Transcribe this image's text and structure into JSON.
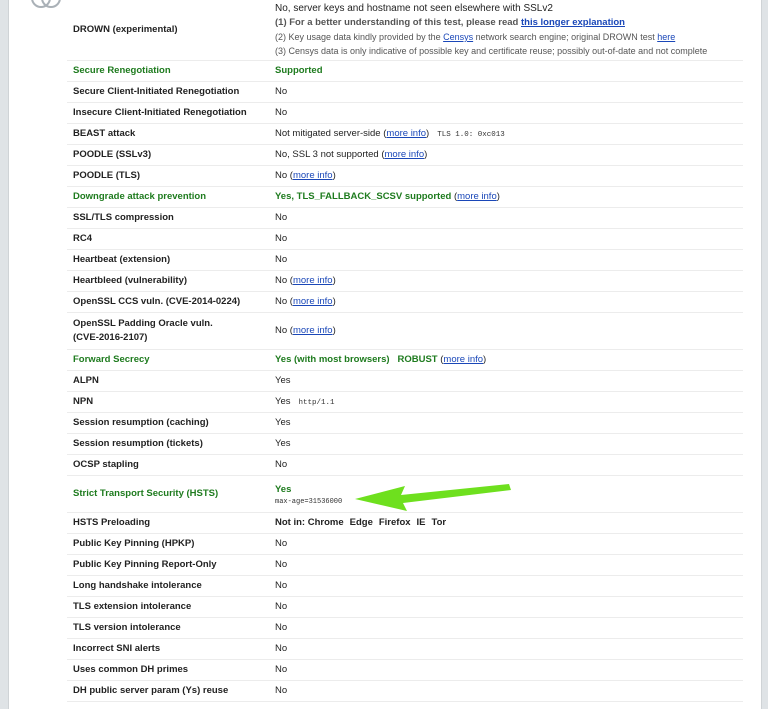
{
  "drown": {
    "label": "DROWN (experimental)",
    "line1": "No, server keys and hostname not seen elsewhere with SSLv2",
    "line2_prefix": "(1) For a better understanding of this test, please read ",
    "line2_link": "this longer explanation",
    "line3_prefix": "(2) Key usage data kindly provided by the ",
    "line3_link1": "Censys",
    "line3_mid": " network search engine; original DROWN test ",
    "line3_link2": "here",
    "line4": "(3) Censys data is only indicative of possible key and certificate reuse; possibly out-of-date and not complete"
  },
  "rows": {
    "secure_reneg": {
      "label": "Secure Renegotiation",
      "value": "Supported"
    },
    "secure_client": {
      "label": "Secure Client-Initiated Renegotiation",
      "value": "No"
    },
    "insecure_client": {
      "label": "Insecure Client-Initiated Renegotiation",
      "value": "No"
    },
    "beast": {
      "label": "BEAST attack",
      "value": "Not mitigated server-side (",
      "link": "more info",
      "after": ")",
      "extra": "TLS 1.0: 0xc013"
    },
    "poodle_ssl": {
      "label": "POODLE (SSLv3)",
      "value": "No, SSL 3 not supported (",
      "link": "more info",
      "after": ")"
    },
    "poodle_tls": {
      "label": "POODLE (TLS)",
      "value": "No (",
      "link": "more info",
      "after": ")"
    },
    "downgrade": {
      "label": "Downgrade attack prevention",
      "value": "Yes, TLS_FALLBACK_SCSV supported",
      "pre": " (",
      "link": "more info",
      "after": ")"
    },
    "compression": {
      "label": "SSL/TLS compression",
      "value": "No"
    },
    "rc4": {
      "label": "RC4",
      "value": "No"
    },
    "heartbeat": {
      "label": "Heartbeat (extension)",
      "value": "No"
    },
    "heartbleed": {
      "label": "Heartbleed (vulnerability)",
      "value": "No (",
      "link": "more info",
      "after": ")"
    },
    "ccs": {
      "label": "OpenSSL CCS vuln. (CVE-2014-0224)",
      "value": "No (",
      "link": "more info",
      "after": ")"
    },
    "padding": {
      "label1": "OpenSSL Padding Oracle vuln.",
      "label2": "(CVE-2016-2107)",
      "value": "No (",
      "link": "more info",
      "after": ")"
    },
    "fs": {
      "label": "Forward Secrecy",
      "value": "Yes (with most browsers)",
      "robust": "ROBUST",
      "pre": " (",
      "link": "more info",
      "after": ")"
    },
    "alpn": {
      "label": "ALPN",
      "value": "Yes"
    },
    "npn": {
      "label": "NPN",
      "value": "Yes",
      "extra": "http/1.1"
    },
    "sess_cache": {
      "label": "Session resumption (caching)",
      "value": "Yes"
    },
    "sess_tickets": {
      "label": "Session resumption (tickets)",
      "value": "Yes"
    },
    "ocsp": {
      "label": "OCSP stapling",
      "value": "No"
    },
    "hsts": {
      "label": "Strict Transport Security (HSTS)",
      "value": "Yes",
      "extra": "max-age=31536000"
    },
    "hsts_preload": {
      "label": "HSTS Preloading",
      "prefix": "Not in: ",
      "browsers": [
        "Chrome",
        "Edge",
        "Firefox",
        "IE",
        "Tor"
      ]
    },
    "hpkp": {
      "label": "Public Key Pinning (HPKP)",
      "value": "No"
    },
    "hpkp_ro": {
      "label": "Public Key Pinning Report-Only",
      "value": "No"
    },
    "long_hs": {
      "label": "Long handshake intolerance",
      "value": "No"
    },
    "tls_ext": {
      "label": "TLS extension intolerance",
      "value": "No"
    },
    "tls_ver": {
      "label": "TLS version intolerance",
      "value": "No"
    },
    "sni": {
      "label": "Incorrect SNI alerts",
      "value": "No"
    },
    "dh_primes": {
      "label": "Uses common DH primes",
      "value": "No"
    },
    "dh_reuse": {
      "label": "DH public server param (Ys) reuse",
      "value": "No"
    }
  },
  "colors": {
    "good": "#1e7b1e",
    "link": "#1a47b8",
    "arrow": "#6ee01e"
  },
  "icons": {
    "corner": "refresh-icon",
    "annotation": "green-arrow-icon"
  }
}
